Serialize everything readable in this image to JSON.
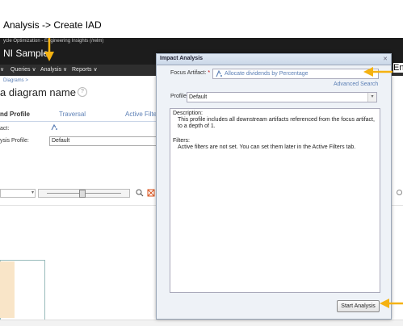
{
  "annotation": {
    "caption": "Analysis -> Create IAD",
    "cutoff_label": "En"
  },
  "header": {
    "subtitle": "ycle Optimization - Engineering Insights (/relm)",
    "app_name": "NI Sample"
  },
  "nav": {
    "items": [
      {
        "label": "∨"
      },
      {
        "label": "Queries ∨"
      },
      {
        "label": "Analysis ∨"
      },
      {
        "label": "Reports ∨"
      }
    ]
  },
  "page": {
    "breadcrumb": "Diagrams >",
    "title": "a diagram name",
    "help": "?",
    "tabs": [
      {
        "label": "nd Profile",
        "active": true
      },
      {
        "label": "Traversal",
        "active": false
      },
      {
        "label": "Active Filters",
        "active": false
      }
    ],
    "artifact_label": "act:",
    "profile_label": "ysis Profile:",
    "profile_value": "Default"
  },
  "dialog": {
    "title": "Impact Analysis",
    "close": "✕",
    "focus_label": "Focus Artifact:",
    "required_mark": "*",
    "focus_value": "Allocate dividends by Percentage",
    "advanced_search": "Advanced Search",
    "profile_label": "Profile",
    "profile_value": "Default",
    "description_heading": "Description:",
    "description_text": "This profile includes all downstream artifacts referenced from the focus artifact, to a depth of 1.",
    "filters_heading": "Filters:",
    "filters_text": "Active filters are not set. You can set them later in the Active Filters tab.",
    "start_button": "Start Analysis"
  },
  "colors": {
    "topbar": "#1c1c1c",
    "link": "#5b7fb5",
    "arrow": "#f5b211",
    "dialog_bg": "#eef2f7"
  }
}
